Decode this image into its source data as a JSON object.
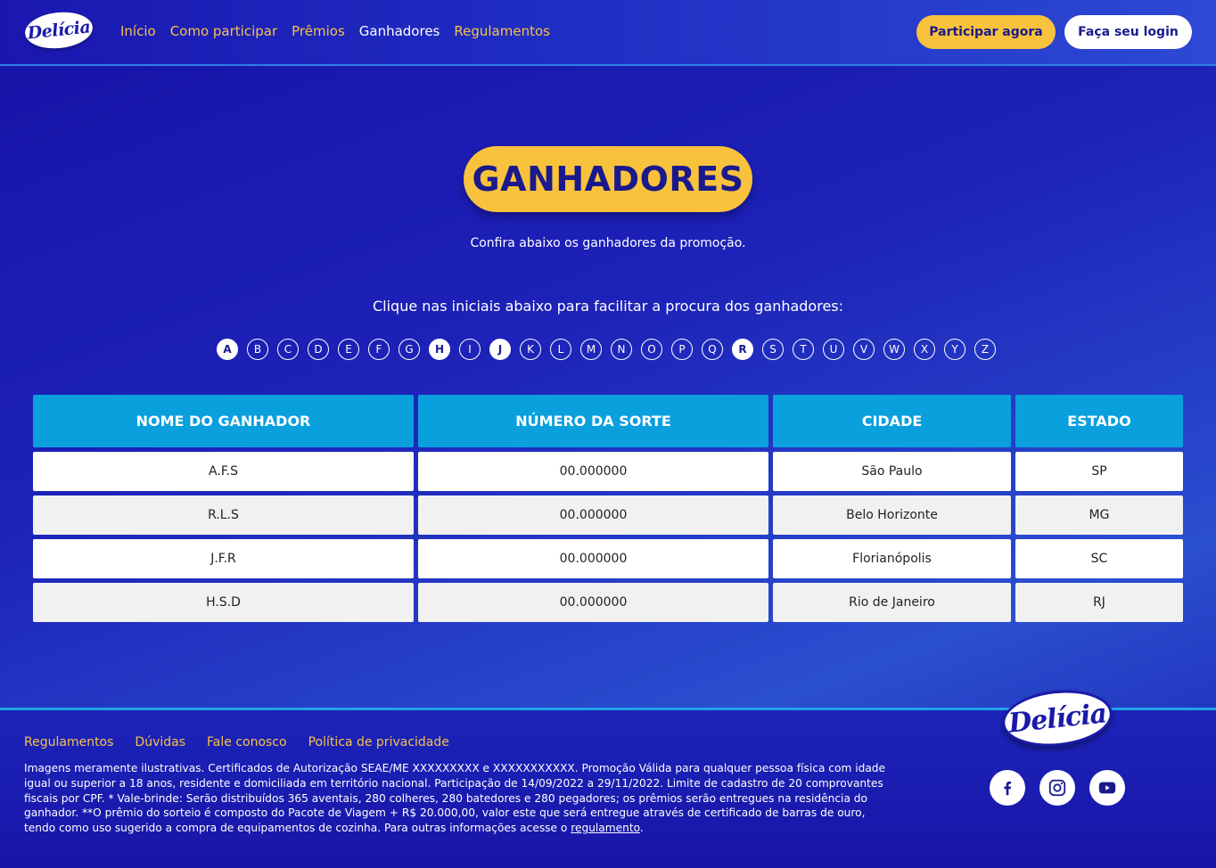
{
  "header": {
    "logo_text": "Delícia",
    "nav": [
      {
        "label": "Início",
        "active": false
      },
      {
        "label": "Como participar",
        "active": false
      },
      {
        "label": "Prêmios",
        "active": false
      },
      {
        "label": "Ganhadores",
        "active": true
      },
      {
        "label": "Regulamentos",
        "active": false
      }
    ],
    "participate_label": "Participar agora",
    "login_label": "Faça seu login"
  },
  "main": {
    "title": "GANHADORES",
    "subtitle": "Confira abaixo os ganhadores da promoção.",
    "instruction": "Clique nas iniciais abaixo para facilitar a procura dos ganhadores:",
    "letters": [
      "A",
      "B",
      "C",
      "D",
      "E",
      "F",
      "G",
      "H",
      "I",
      "J",
      "K",
      "L",
      "M",
      "N",
      "O",
      "P",
      "Q",
      "R",
      "S",
      "T",
      "U",
      "V",
      "W",
      "X",
      "Y",
      "Z"
    ],
    "letters_with_winners": [
      "A",
      "H",
      "J",
      "R"
    ]
  },
  "table": {
    "headers": [
      "NOME DO GANHADOR",
      "NÚMERO DA SORTE",
      "CIDADE",
      "ESTADO"
    ],
    "rows": [
      [
        "A.F.S",
        "00.000000",
        "São Paulo",
        "SP"
      ],
      [
        "R.L.S",
        "00.000000",
        "Belo Horizonte",
        "MG"
      ],
      [
        "J.F.R",
        "00.000000",
        "Florianópolis",
        "SC"
      ],
      [
        "H.S.D",
        "00.000000",
        "Rio de Janeiro",
        "RJ"
      ]
    ]
  },
  "footer": {
    "links": [
      "Regulamentos",
      "Dúvidas",
      "Fale conosco",
      "Política de privacidade"
    ],
    "disclaimer": "Imagens meramente ilustrativas. Certificados de Autorização SEAE/ME XXXXXXXXX e XXXXXXXXXXX. Promoção Válida para qualquer pessoa física com idade igual ou superior a 18 anos, residente e domiciliada em território nacional. Participação de 14/09/2022 a 29/11/2022. Limite de cadastro de 20 comprovantes fiscais por CPF. * Vale-brinde: Serão distribuídos 365 aventais, 280 colheres, 280 batedores  e 280 pegadores; os prêmios serão entregues na residência do ganhador. **O prêmio do sorteio é composto do Pacote de Viagem + R$ 20.000,00, valor este que será entregue através de certificado de barras de ouro, tendo como uso sugerido a compra de equipamentos de cozinha. Para outras informações acesse o ",
    "disclaimer_link": "regulamento",
    "disclaimer_end": ".",
    "logo_text": "Delícia",
    "socials": [
      "facebook-icon",
      "instagram-icon",
      "youtube-icon"
    ]
  },
  "colors": {
    "brand_blue": "#1a1a8c",
    "accent_yellow": "#f9c23d",
    "header_cell": "#0aa0de",
    "link_yellow": "#f6c14a"
  }
}
